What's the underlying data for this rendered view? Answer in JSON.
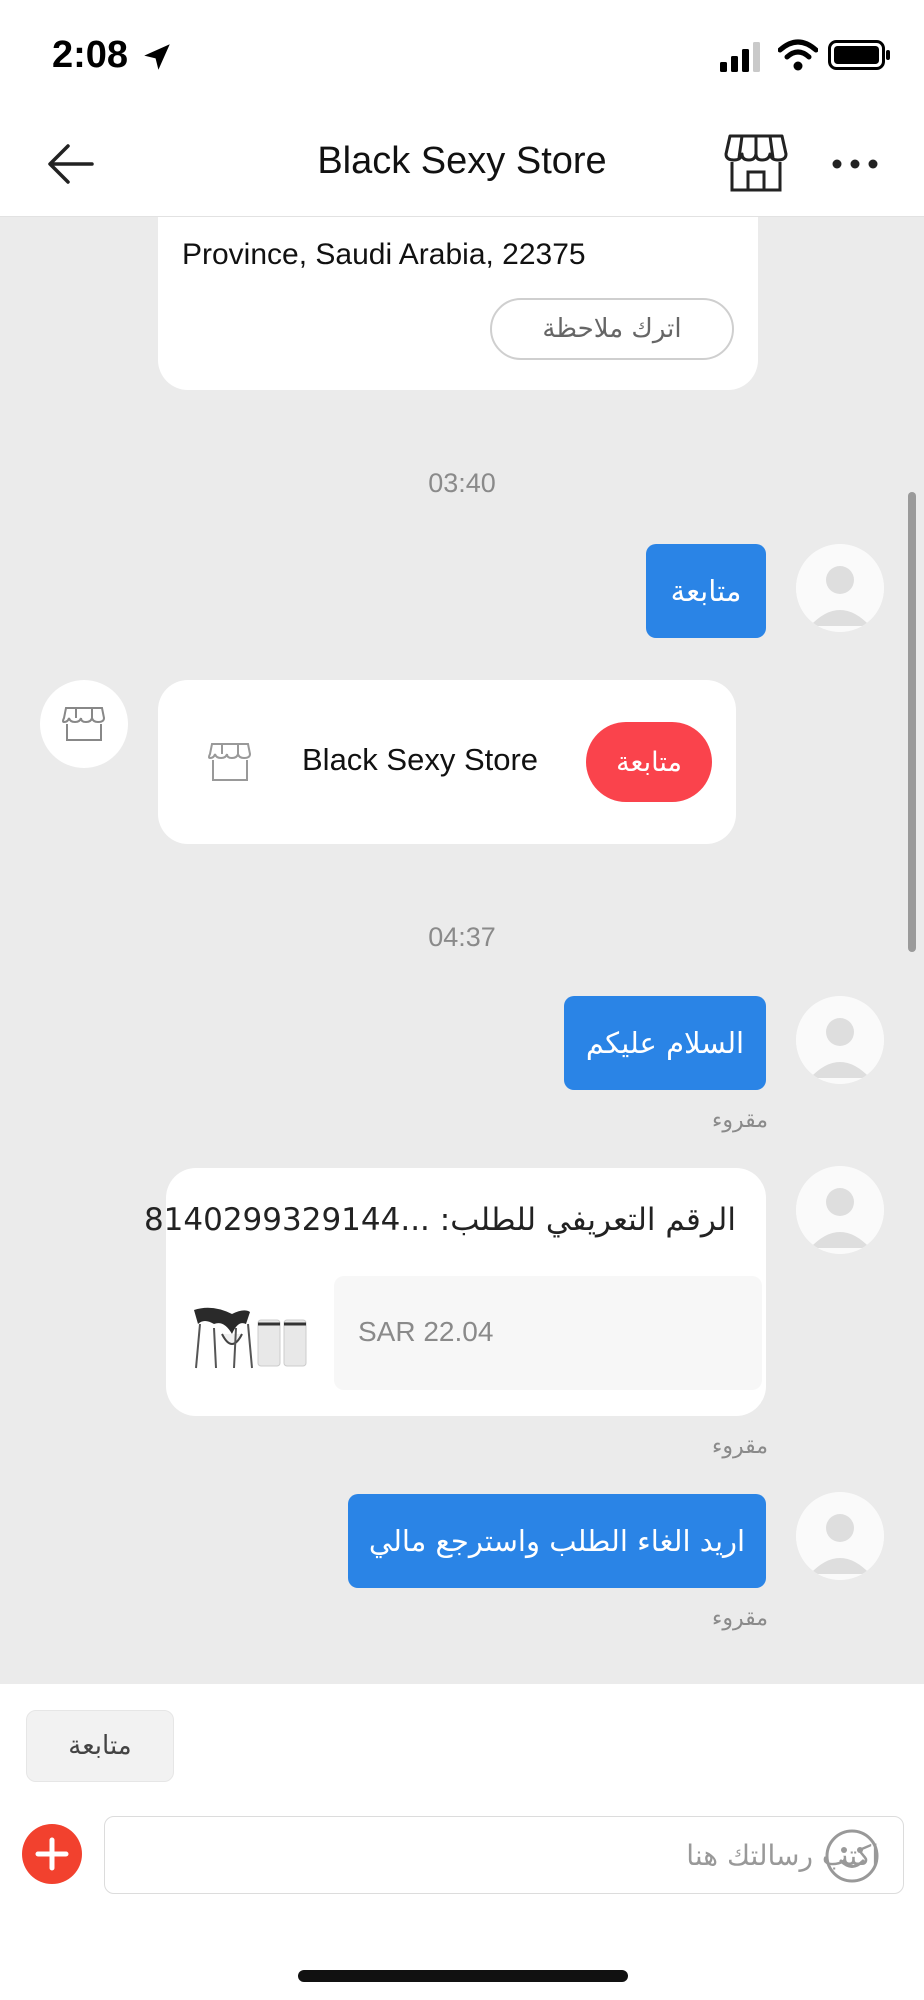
{
  "status_bar": {
    "time": "2:08"
  },
  "header": {
    "title": "Black Sexy Store"
  },
  "chat": {
    "address_card": {
      "address_tail": "Province, Saudi Arabia, 22375",
      "note_button": "اترك ملاحظة"
    },
    "time_1": "03:40",
    "msg_follow": "متابعة",
    "store_card": {
      "store_name": "Black Sexy Store",
      "follow_button": "متابعة"
    },
    "time_2": "04:37",
    "msg_greeting": "السلام عليكم",
    "read_1": "مقروء",
    "order_card": {
      "title": "الرقم التعريفي للطلب: ...8140299329144",
      "price": "SAR 22.04"
    },
    "read_2": "مقروء",
    "msg_refund": "اريد الغاء الطلب واسترجع مالي",
    "read_3": "مقروء"
  },
  "composer": {
    "quick_reply": "متابعة",
    "placeholder": "اكتب رسالتك هنا"
  },
  "colors": {
    "bubble_blue": "#2a84e6",
    "follow_red": "#fa434c",
    "plus_red": "#f2412e",
    "chat_background": "#ebebeb"
  },
  "icons": [
    "location-arrow-icon",
    "signal-icon",
    "wifi-icon",
    "battery-icon",
    "back-arrow-icon",
    "store-icon",
    "more-icon",
    "avatar-icon",
    "plus-icon",
    "emoji-icon"
  ]
}
